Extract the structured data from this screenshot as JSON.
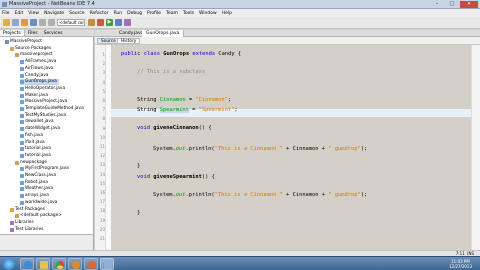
{
  "window": {
    "title": "MassiveProject - NetBeans IDE 7.4"
  },
  "menu": [
    "File",
    "Edit",
    "View",
    "Navigate",
    "Source",
    "Refactor",
    "Run",
    "Debug",
    "Profile",
    "Team",
    "Tools",
    "Window",
    "Help"
  ],
  "toolbar": {
    "config_select": "<default config>"
  },
  "left_tabs": [
    "Projects",
    "Files",
    "Services"
  ],
  "tree": [
    {
      "label": "MassiveProject",
      "icon": "project-icon",
      "indent": 1
    },
    {
      "label": "Source Packages",
      "icon": "folder-icon",
      "indent": 2
    },
    {
      "label": "massiveproject",
      "icon": "package-icon",
      "indent": 3
    },
    {
      "label": "AllFrames.java",
      "icon": "java-file-icon",
      "indent": 4
    },
    {
      "label": "AirFlows.java",
      "icon": "java-file-icon",
      "indent": 4
    },
    {
      "label": "Candy.java",
      "icon": "java-file-icon",
      "indent": 4
    },
    {
      "label": "GunOrops.java",
      "icon": "java-file-icon",
      "indent": 4,
      "selected": true
    },
    {
      "label": "HelloOperator.java",
      "icon": "java-file-icon",
      "indent": 4
    },
    {
      "label": "Maker.java",
      "icon": "java-file-icon",
      "indent": 4
    },
    {
      "label": "MassiveProject.java",
      "icon": "java-file-icon",
      "indent": 4
    },
    {
      "label": "TemplateGuideMethod.java",
      "icon": "java-file-icon",
      "indent": 4
    },
    {
      "label": "TestMyStudies.java",
      "icon": "java-file-icon",
      "indent": 4
    },
    {
      "label": "dewallet.java",
      "icon": "java-file-icon",
      "indent": 4
    },
    {
      "label": "dateWidget.java",
      "icon": "java-file-icon",
      "indent": 4
    },
    {
      "label": "fish.java",
      "icon": "java-file-icon",
      "indent": 4
    },
    {
      "label": "ifixit.java",
      "icon": "java-file-icon",
      "indent": 4
    },
    {
      "label": "tutorial.java",
      "icon": "java-file-icon",
      "indent": 4
    },
    {
      "label": "tutorial.java",
      "icon": "java-file-icon",
      "indent": 4
    },
    {
      "label": "newpackage",
      "icon": "package-icon",
      "indent": 3
    },
    {
      "label": "MyFirstProgram.java",
      "icon": "java-file-icon",
      "indent": 4
    },
    {
      "label": "NewClass.java",
      "icon": "java-file-icon",
      "indent": 4
    },
    {
      "label": "Robot.java",
      "icon": "java-file-icon",
      "indent": 4
    },
    {
      "label": "Weather.java",
      "icon": "java-file-icon",
      "indent": 4
    },
    {
      "label": "arrays.java",
      "icon": "java-file-icon",
      "indent": 4
    },
    {
      "label": "worldwide.java",
      "icon": "java-file-icon",
      "indent": 4
    },
    {
      "label": "Test Packages",
      "icon": "folder-icon",
      "indent": 2
    },
    {
      "label": "<default package>",
      "icon": "package-icon",
      "indent": 3
    },
    {
      "label": "Libraries",
      "icon": "library-icon",
      "indent": 2
    },
    {
      "label": "Test Libraries",
      "icon": "library-icon",
      "indent": 2
    }
  ],
  "editor_tabs": [
    "Candy.java",
    "GunOrops.java"
  ],
  "editor_toolbar": {
    "source": "Source",
    "history": "History"
  },
  "line_numbers": [
    "1",
    "2",
    "3",
    "4",
    "5",
    "6",
    "7",
    "8",
    "9",
    "10",
    "11",
    "12",
    "13",
    "14",
    "15",
    "16",
    "17",
    "18",
    "19",
    "20",
    "21"
  ],
  "code": {
    "l1_kw": "public class ",
    "l1_cls": "GunOrops ",
    "l1_kw2": "extends ",
    "l1_rest": "Candy {",
    "l3_cmt": "// This is a subclass",
    "l5_type": "String ",
    "l5_fld": "Cinnamon",
    "l5_eq": " = ",
    "l5_str": "\"Cinnamon\"",
    "l5_end": ";",
    "l6_type": "String ",
    "l6_fld": "Spearmint",
    "l6_eq": " = ",
    "l6_str": "\"Spearmint\"",
    "l6_end": ";",
    "l8_kw": "void ",
    "l8_mth": "giveneCinnanon",
    "l8_rest": "() {",
    "l10_a": "System.",
    "l10_out": "out",
    "l10_b": ".println(",
    "l10_s1": "\"This is a Cinnamon \"",
    "l10_c": " + Cinnamon + ",
    "l10_s2": "\" gumdrop\"",
    "l10_d": ");",
    "l12_end": "}",
    "l14_kw": "void ",
    "l14_mth": "giveneSpearmint",
    "l14_rest": "() {",
    "l16_a": "System.",
    "l16_out": "out",
    "l16_b": ".println(",
    "l16_s1": "\"This is a Cinnamon \"",
    "l16_c": " + Cinnamon + ",
    "l16_s2": "\" gumdrop\"",
    "l16_d": ");",
    "l18_end": "}"
  },
  "status": {
    "position": "7:11",
    "mode": "INS"
  },
  "clock": {
    "time": "11:03 PM",
    "date": "12/27/2013"
  },
  "colors": {
    "keyword": "#0000cc",
    "string": "#ce7b00",
    "field": "#009900",
    "comment": "#8a8a8a"
  }
}
